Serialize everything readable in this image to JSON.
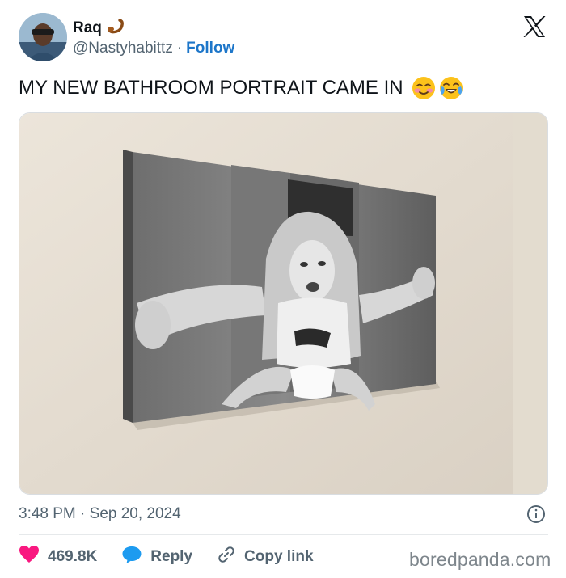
{
  "author": {
    "display_name": "Raq",
    "handle": "@Nastyhabittz",
    "separator": "·",
    "follow_label": "Follow"
  },
  "tweet": {
    "text": "MY NEW BATHROOM PORTRAIT CAME IN",
    "emojis": [
      "smiling-face-with-blush-icon",
      "face-with-tears-of-joy-icon"
    ],
    "timestamp": "3:48 PM · Sep 20, 2024"
  },
  "actions": {
    "like_count": "469.8K",
    "reply_label": "Reply",
    "copy_link_label": "Copy link"
  },
  "watermark": "boredpanda.com",
  "colors": {
    "follow_blue": "#1d76c9",
    "like_red": "#f91880",
    "reply_blue": "#1d9bf0",
    "muted_text": "#536471"
  }
}
